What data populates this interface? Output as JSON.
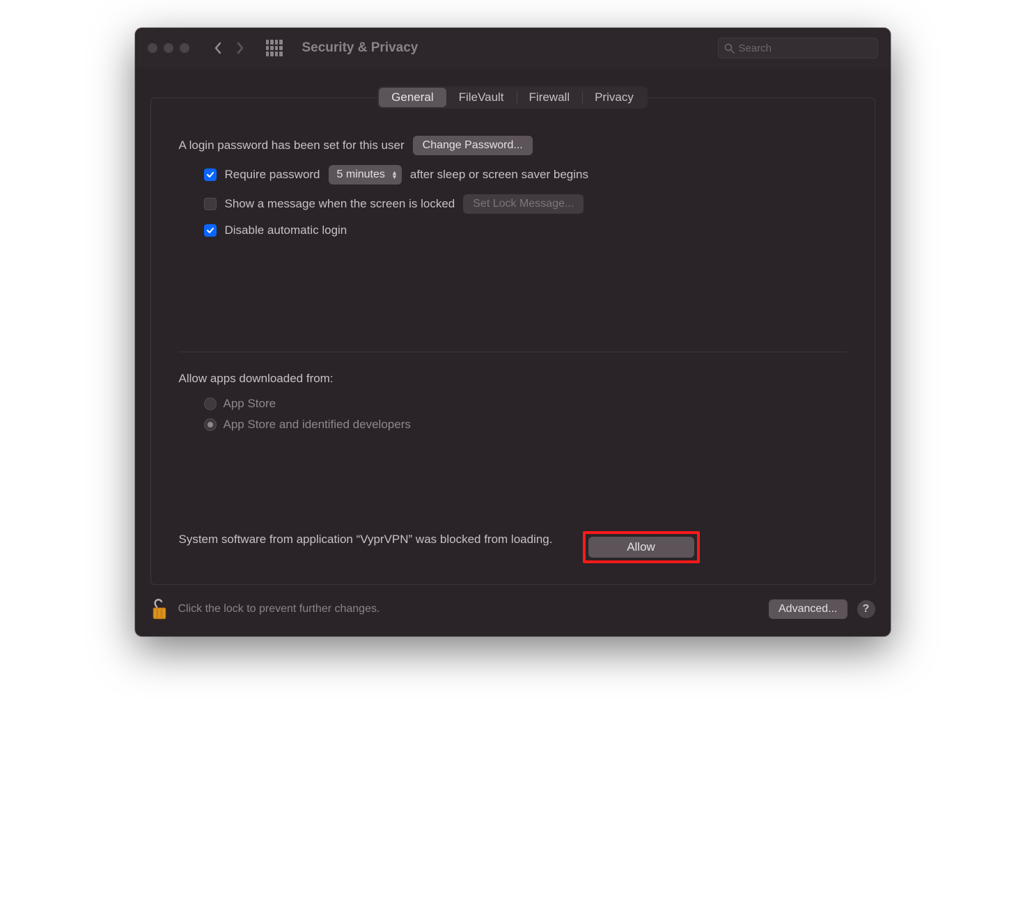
{
  "titlebar": {
    "title": "Security & Privacy",
    "search_placeholder": "Search"
  },
  "tabs": {
    "items": [
      {
        "label": "General",
        "active": true
      },
      {
        "label": "FileVault",
        "active": false
      },
      {
        "label": "Firewall",
        "active": false
      },
      {
        "label": "Privacy",
        "active": false
      }
    ]
  },
  "login": {
    "password_set_text": "A login password has been set for this user",
    "change_password_label": "Change Password...",
    "require_password_label": "Require password",
    "require_password_checked": true,
    "delay_value": "5 minutes",
    "after_sleep_text": "after sleep or screen saver begins",
    "show_message_label": "Show a message when the screen is locked",
    "show_message_checked": false,
    "set_lock_message_label": "Set Lock Message...",
    "disable_auto_login_label": "Disable automatic login",
    "disable_auto_login_checked": true
  },
  "gatekeeper": {
    "section_label": "Allow apps downloaded from:",
    "options": [
      {
        "label": "App Store",
        "selected": false
      },
      {
        "label": "App Store and identified developers",
        "selected": true
      }
    ]
  },
  "blocked": {
    "text": "System software from application “VyprVPN” was blocked from loading.",
    "allow_label": "Allow"
  },
  "footer": {
    "lock_text": "Click the lock to prevent further changes.",
    "advanced_label": "Advanced...",
    "help_label": "?"
  }
}
